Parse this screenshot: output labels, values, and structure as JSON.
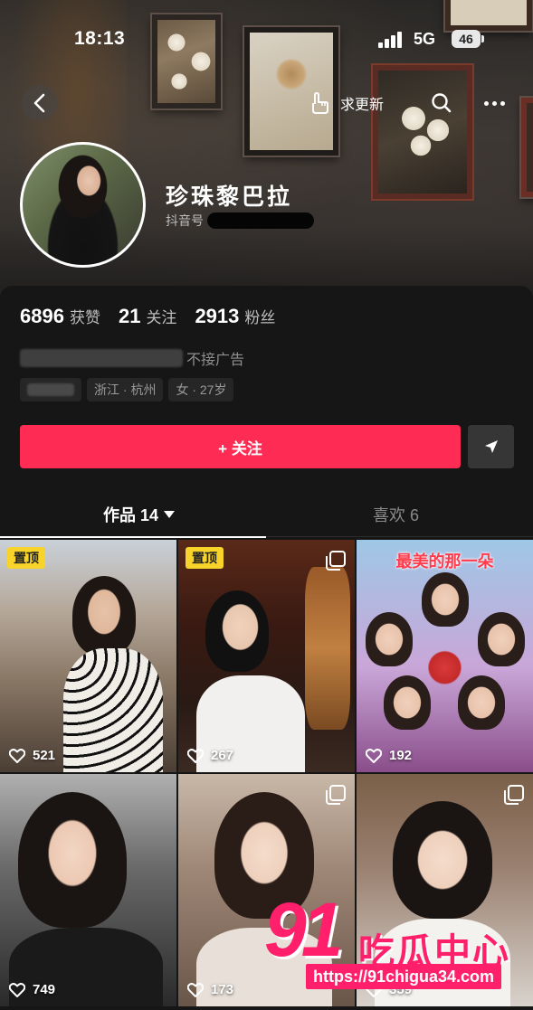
{
  "status_bar": {
    "time": "18:13",
    "network": "5G",
    "battery": "46"
  },
  "nav": {
    "update_label": "求更新"
  },
  "profile": {
    "name": "珍珠黎巴拉",
    "account_prefix": "抖音号",
    "stats": [
      {
        "value": "6896",
        "label": "获赞"
      },
      {
        "value": "21",
        "label": "关注"
      },
      {
        "value": "2913",
        "label": "粉丝"
      }
    ],
    "bio_visible": "不接广告",
    "tags": [
      "浙江 · 杭州",
      "女 · 27岁"
    ]
  },
  "actions": {
    "follow_label": "+ 关注"
  },
  "tabs": {
    "works": "作品 14",
    "likes": "喜欢 6"
  },
  "videos": [
    {
      "likes": "521",
      "pinned": "置顶",
      "multi": false
    },
    {
      "likes": "267",
      "pinned": "置顶",
      "multi": true
    },
    {
      "likes": "192",
      "caption": "最美的那一朵",
      "multi": false
    },
    {
      "likes": "749",
      "multi": false
    },
    {
      "likes": "173",
      "multi": true
    },
    {
      "likes": "359",
      "multi": true
    }
  ],
  "watermark": {
    "logo": "91",
    "brand": "吃瓜中心",
    "url": "https://91chigua34.com"
  },
  "colors": {
    "accent": "#fe2c55",
    "pin": "#f8d32a",
    "background": "#161616"
  }
}
